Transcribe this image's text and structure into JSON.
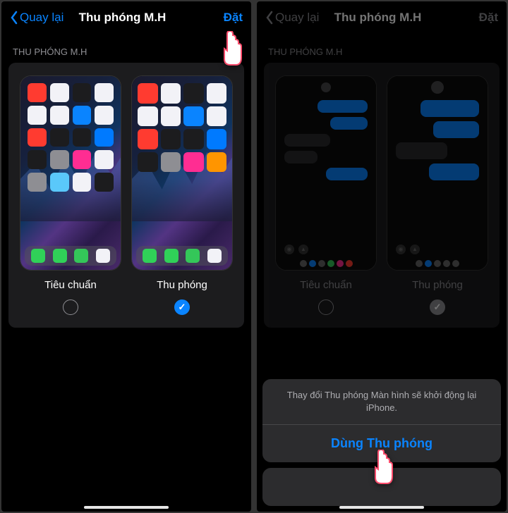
{
  "left": {
    "nav": {
      "back": "Quay lại",
      "title": "Thu phóng M.H",
      "action": "Đặt"
    },
    "section": "THU PHÓNG M.H",
    "previews": {
      "standard": "Tiêu chuẩn",
      "zoomed": "Thu phóng"
    }
  },
  "right": {
    "nav": {
      "back": "Quay lại",
      "title": "Thu phóng M.H",
      "action": "Đặt"
    },
    "section": "THU PHÓNG M.H",
    "previews": {
      "standard": "Tiêu chuẩn",
      "zoomed": "Thu phóng"
    },
    "sheet": {
      "message": "Thay đổi Thu phóng Màn hình sẽ khởi động lại iPhone.",
      "confirm": "Dùng Thu phóng"
    }
  }
}
